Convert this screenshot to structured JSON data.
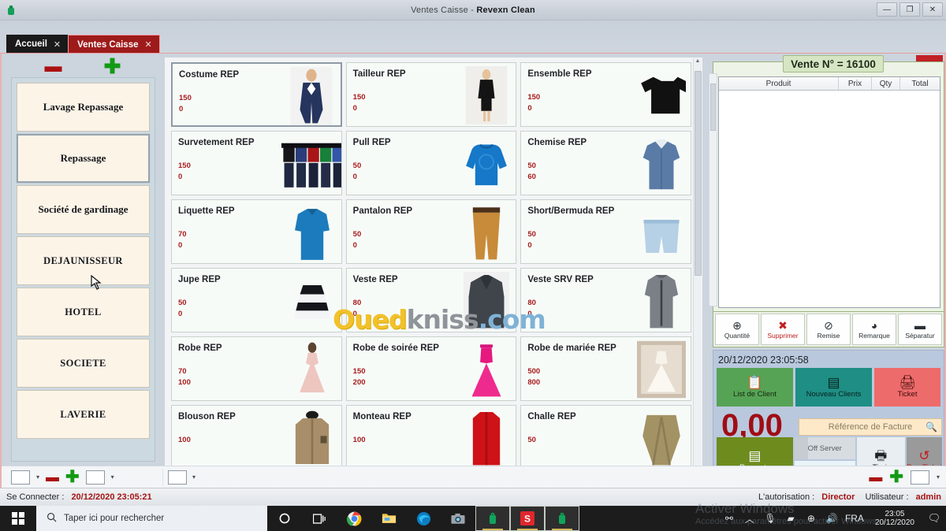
{
  "window": {
    "title_prefix": "Ventes Caisse - ",
    "title_app": "Revexn Clean",
    "app_icon": "app-icon",
    "minimize": "—",
    "maximize": "❐",
    "close": "✕"
  },
  "tabs": [
    {
      "label": "Accueil",
      "close": "✕",
      "active": false
    },
    {
      "label": "Ventes Caisse",
      "close": "✕",
      "active": true
    }
  ],
  "sidebar": {
    "remove_icon": "minus-icon",
    "add_icon": "plus-icon",
    "items": [
      {
        "label": "Lavage Repassage",
        "selected": false
      },
      {
        "label": "Repassage",
        "selected": true
      },
      {
        "label": "Société de gardinage",
        "selected": false
      },
      {
        "label": "DEJAUNISSEUR",
        "selected": false
      },
      {
        "label": "HOTEL",
        "selected": false
      },
      {
        "label": "SOCIETE",
        "selected": false
      },
      {
        "label": "LAVERIE",
        "selected": false
      }
    ]
  },
  "products": [
    {
      "name": "Costume REP",
      "price1": "150",
      "price2": "0",
      "selected": true
    },
    {
      "name": "Tailleur REP",
      "price1": "150",
      "price2": "0",
      "selected": false
    },
    {
      "name": "Ensemble REP",
      "price1": "150",
      "price2": "0",
      "selected": false
    },
    {
      "name": "Survetement REP",
      "price1": "150",
      "price2": "0",
      "selected": false
    },
    {
      "name": "Pull REP",
      "price1": "50",
      "price2": "0",
      "selected": false
    },
    {
      "name": "Chemise REP",
      "price1": "50",
      "price2": "60",
      "selected": false
    },
    {
      "name": "Liquette REP",
      "price1": "70",
      "price2": "0",
      "selected": false
    },
    {
      "name": "Pantalon REP",
      "price1": "50",
      "price2": "0",
      "selected": false
    },
    {
      "name": "Short/Bermuda REP",
      "price1": "50",
      "price2": "0",
      "selected": false
    },
    {
      "name": "Jupe REP",
      "price1": "50",
      "price2": "0",
      "selected": false
    },
    {
      "name": "Veste REP",
      "price1": "80",
      "price2": "0",
      "selected": false
    },
    {
      "name": "Veste SRV REP",
      "price1": "80",
      "price2": "0",
      "selected": false
    },
    {
      "name": "Robe REP",
      "price1": "70",
      "price2": "100",
      "selected": false
    },
    {
      "name": "Robe de soirée REP",
      "price1": "150",
      "price2": "200",
      "selected": false
    },
    {
      "name": "Robe de mariée REP",
      "price1": "500",
      "price2": "800",
      "selected": false
    },
    {
      "name": "Blouson REP",
      "price1": "100",
      "price2": "",
      "selected": false
    },
    {
      "name": "Monteau REP",
      "price1": "100",
      "price2": "",
      "selected": false
    },
    {
      "name": "Challe REP",
      "price1": "50",
      "price2": "",
      "selected": false
    }
  ],
  "cart": {
    "vente_label": "Vente N° = 16100",
    "columns": [
      "Produit",
      "Prix",
      "Qty",
      "Total"
    ],
    "rows": []
  },
  "cart_actions": [
    {
      "label": "Quantité",
      "glyph": "⊕",
      "icon": "plus-circle-icon"
    },
    {
      "label": "Supprimer",
      "glyph": "✖",
      "icon": "delete-x-icon"
    },
    {
      "label": "Remise",
      "glyph": "%",
      "icon": "percent-circle-icon"
    },
    {
      "label": "Remarque",
      "glyph": "🗨",
      "icon": "comment-icon"
    },
    {
      "label": "Séparatur",
      "glyph": "▬",
      "icon": "separator-icon"
    }
  ],
  "lower": {
    "datetime": "20/12/2020 23:05:58",
    "tiles_top": [
      {
        "label": "List de Client",
        "icon": "clipboard-icon",
        "glyph": "📋"
      },
      {
        "label": "Nouveau Clients",
        "icon": "id-card-icon",
        "glyph": "🪪"
      },
      {
        "label": "Ticket",
        "icon": "printer-icon",
        "glyph": "🖨"
      }
    ],
    "amount": "0,00",
    "reference_placeholder": "Référence de Facture",
    "search_icon": "magnifier-icon",
    "tiles_bottom": [
      {
        "label": "Rapports",
        "icon": "report-icon",
        "glyph": "📄"
      },
      {
        "label": "Off Server",
        "icon": "server-icon",
        "glyph": ""
      },
      {
        "label": "",
        "icon": "alarm-icon",
        "glyph": "🚨"
      },
      {
        "label": "Tiroir",
        "icon": "cash-drawer-icon",
        "glyph": "🗄"
      },
      {
        "label": "Rap.Ticket",
        "icon": "reprint-icon",
        "glyph": "↺"
      }
    ]
  },
  "bottom_toolbar": {
    "minus": "minus-icon",
    "plus": "plus-icon",
    "caret": "▾"
  },
  "statusbar": {
    "connect_label": "Se Connecter :",
    "connect_time": "20/12/2020 23:05:21",
    "auth_label": "L'autorisation :",
    "auth_value": "Director",
    "user_label": "Utilisateur :",
    "user_value": "admin"
  },
  "taskbar": {
    "start_icon": "windows-start-icon",
    "search_icon": "search-icon",
    "search_placeholder": "Taper ici pour rechercher",
    "apps": [
      {
        "icon": "cortana-icon",
        "glyph": "◯"
      },
      {
        "icon": "task-view-icon",
        "glyph": "❏"
      },
      {
        "icon": "chrome-icon",
        "glyph": ""
      },
      {
        "icon": "file-explorer-icon",
        "glyph": ""
      },
      {
        "icon": "edge-icon",
        "glyph": ""
      },
      {
        "icon": "camera-icon",
        "glyph": "📷"
      },
      {
        "icon": "revexn-app-icon",
        "glyph": ""
      },
      {
        "icon": "snagit-icon",
        "glyph": "S"
      },
      {
        "icon": "revexn-app2-icon",
        "glyph": ""
      }
    ],
    "tray": [
      {
        "icon": "people-share-icon",
        "glyph": "⚲"
      },
      {
        "icon": "chevron-up-icon",
        "glyph": "︿"
      },
      {
        "icon": "microphone-icon",
        "glyph": "🎤"
      },
      {
        "icon": "battery-icon",
        "glyph": "🔋"
      },
      {
        "icon": "network-icon",
        "glyph": "🌐"
      },
      {
        "icon": "volume-icon",
        "glyph": "🔊"
      }
    ],
    "language": "FRA",
    "clock_time": "23:05",
    "clock_date": "20/12/2020",
    "notification_icon": "notification-icon"
  },
  "overlays": {
    "watermark_a": "Oued",
    "watermark_b": "kniss",
    "watermark_c": ".com",
    "activate_title": "Activer Windows",
    "activate_sub": "Accédez aux paramètres pour activer Windows."
  },
  "colors": {
    "accent_red": "#9e1b1b",
    "tab_home": "#1a1a1a",
    "price": "#a81c1c",
    "amount": "#a00d15",
    "green_tile": "#57a355",
    "teal_tile": "#1f8e84",
    "red_tile": "#ee6b6b",
    "olive_tile": "#6e8c1e"
  }
}
